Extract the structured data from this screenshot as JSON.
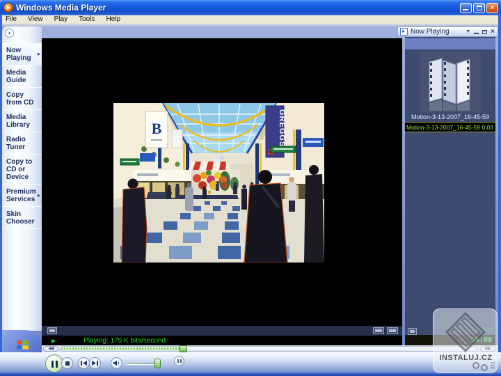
{
  "window": {
    "title": "Windows Media Player",
    "menu_items": [
      "File",
      "View",
      "Play",
      "Tools",
      "Help"
    ]
  },
  "sidebar": {
    "items": [
      {
        "label": "Now Playing",
        "arrow": "▸"
      },
      {
        "label": "Media Guide"
      },
      {
        "label": "Copy from CD"
      },
      {
        "label": "Media Library"
      },
      {
        "label": "Radio Tuner"
      },
      {
        "label": "Copy to CD or Device"
      },
      {
        "label": "Premium Services",
        "arrow": "▸"
      },
      {
        "label": "Skin Chooser"
      }
    ]
  },
  "now_playing": {
    "header_title": "Now Playing",
    "thumbnail_caption": "Motion-3-13-2007_16-45-59",
    "playlist_item": {
      "title": "Motion-3-13-2007_16-45-59",
      "duration": "0:03"
    },
    "total_time": "Total Time: 0:03",
    "elapsed": "00:00"
  },
  "status": {
    "playing_text": "Playing: 175 K bits/second"
  },
  "video_scene": {
    "sign_left": "B",
    "sign_right": "GREGGS"
  },
  "watermark": {
    "text": "INSTALUJ.CZ"
  },
  "icons": {
    "play_indicator": "▶",
    "rewind": "◀◀",
    "fast_forward": "▶▶",
    "taskbar_chevron": "▴",
    "header_chevron": "▼",
    "close": "×"
  },
  "colors": {
    "xp_blue": "#2a68e0",
    "panel_slate": "#3e4a70",
    "playlist_green": "#a0e838",
    "status_green": "#28cc28",
    "lcd_green": "#46c866"
  }
}
